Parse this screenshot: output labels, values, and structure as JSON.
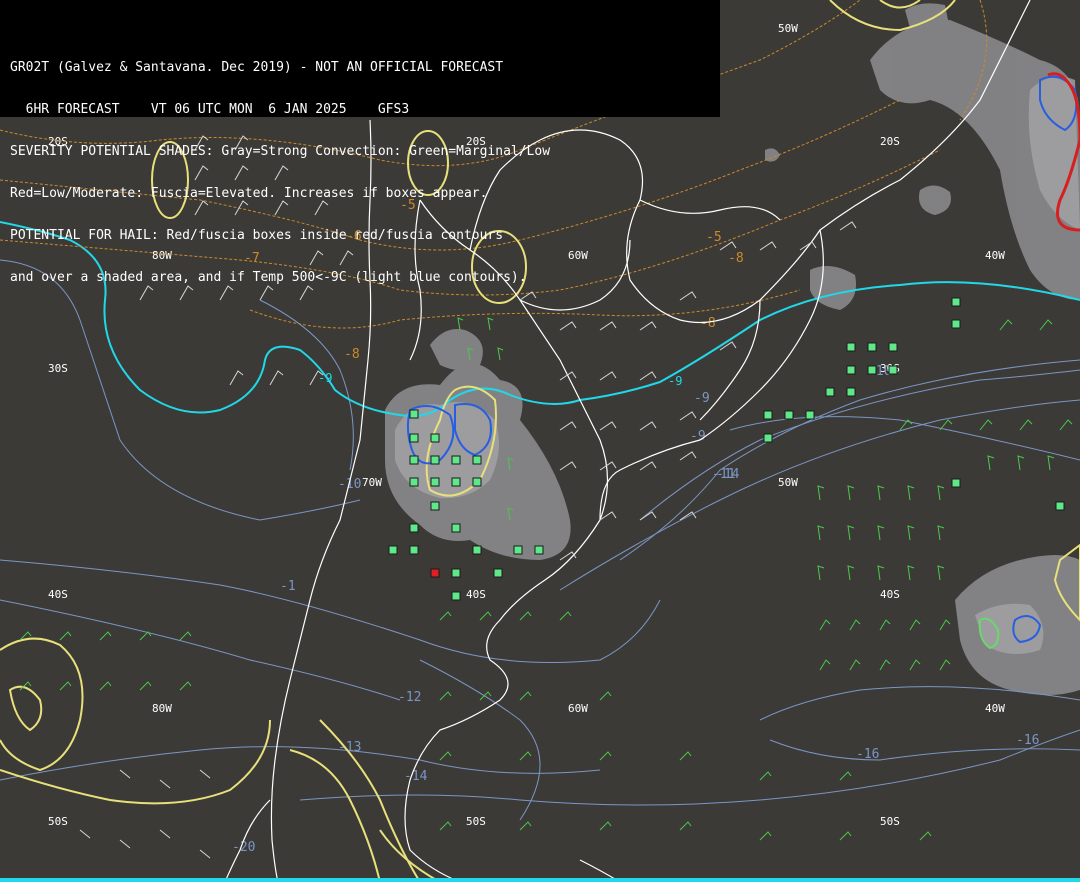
{
  "header": {
    "line1": "GR02T (Galvez & Santavana. Dec 2019) - NOT AN OFFICIAL FORECAST",
    "line2": "  6HR FORECAST    VT 06 UTC MON  6 JAN 2025    GFS3",
    "line3": "SEVERITY POTENTIAL SHADES: Gray=Strong Convection: Green=Marginal/Low",
    "line4": "Red=Low/Moderate: Fuscia=Elevated. Increases if boxes appear.",
    "line5": "POTENTIAL FOR HAIL: Red/fuscia boxes inside red/fuscia contours",
    "line6": "and over a shaded area, and if Temp 500<-9C (light blue contours)."
  },
  "grid_labels": {
    "lat_20s": "20S",
    "lat_30s": "30S",
    "lat_40s": "40S",
    "lat_50s": "50S",
    "lon_80w": "80W",
    "lon_60w": "60W",
    "lon_50w": "50W",
    "lon_40w": "40W",
    "lon_70w": "70W"
  },
  "isotherm_labels": {
    "m9a": "-9",
    "m9b": "-9",
    "m10a": "-10",
    "m10b": "-10",
    "m11": "-11",
    "m12": "-12",
    "m13": "-13",
    "m14a": "-14",
    "m14b": "-14",
    "m16a": "-16",
    "m16b": "-16",
    "m20": "-20",
    "m1": "-1"
  },
  "orange_labels": {
    "o5a": "-5",
    "o5b": "-5",
    "o6": "-6",
    "o7": "-7",
    "o8a": "-8",
    "o8b": "-8",
    "o8c": "-8"
  },
  "colors": {
    "background": "#3c3a37",
    "coastline": "#ffffff",
    "shade_gray": "#8a8a8e",
    "cyan_contour": "#20d8e8",
    "isotherm_blue": "#7b96c4",
    "yellow_contour": "#e8e07a",
    "orange_dashed": "#c98a2a",
    "green_box": "#5ee88a",
    "red_box": "#e02020",
    "barb_green": "#4ac84a",
    "barb_white": "#d8d8d8"
  }
}
